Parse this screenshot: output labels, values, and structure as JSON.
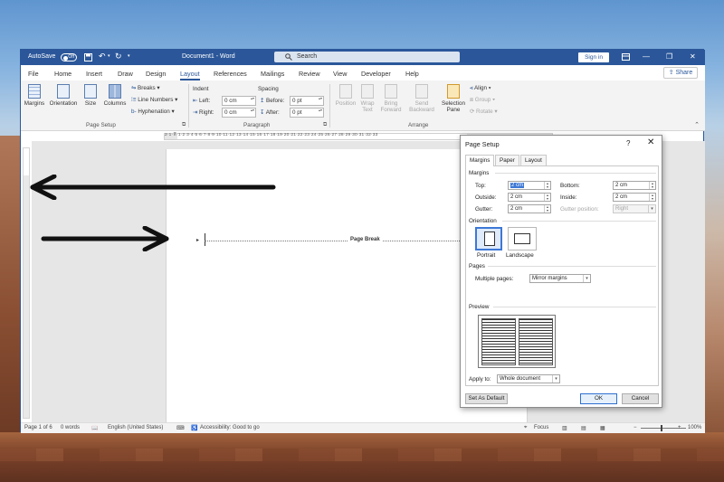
{
  "title_bar": {
    "autosave_label": "AutoSave",
    "autosave_state": "Off",
    "doc_title": "Document1 - Word",
    "search_placeholder": "Search",
    "signin_label": "Sign in",
    "minimize": "—",
    "restore": "❐",
    "close": "✕"
  },
  "tabs": [
    "File",
    "Home",
    "Insert",
    "Draw",
    "Design",
    "Layout",
    "References",
    "Mailings",
    "Review",
    "View",
    "Developer",
    "Help"
  ],
  "active_tab": "Layout",
  "share_label": "Share",
  "ribbon": {
    "page_setup": {
      "margins": "Margins",
      "orientation": "Orientation",
      "size": "Size",
      "columns": "Columns",
      "breaks": "Breaks",
      "line_numbers": "Line Numbers",
      "hyphenation": "Hyphenation",
      "group_label": "Page Setup"
    },
    "paragraph": {
      "indent_header": "Indent",
      "spacing_header": "Spacing",
      "left_label": "Left:",
      "left_value": "0 cm",
      "right_label": "Right:",
      "right_value": "0 cm",
      "before_label": "Before:",
      "before_value": "0 pt",
      "after_label": "After:",
      "after_value": "0 pt",
      "group_label": "Paragraph"
    },
    "arrange": {
      "position": "Position",
      "wrap_text": "Wrap Text",
      "bring_forward": "Bring Forward",
      "send_backward": "Send Backward",
      "selection_pane": "Selection Pane",
      "align": "Align",
      "group": "Group",
      "rotate": "Rotate",
      "group_label": "Arrange"
    }
  },
  "document": {
    "page_break_label": "Page Break"
  },
  "status_bar": {
    "page": "Page 1 of 6",
    "words": "0 words",
    "language": "English (United States)",
    "accessibility": "Accessibility: Good to go",
    "focus": "Focus",
    "zoom_minus": "−",
    "zoom_plus": "+",
    "zoom": "100%"
  },
  "dialog": {
    "title": "Page Setup",
    "help": "?",
    "close": "✕",
    "tabs": [
      "Margins",
      "Paper",
      "Layout"
    ],
    "active_tab": "Margins",
    "margins_header": "Margins",
    "top_label": "Top:",
    "top_value": "2 cm",
    "bottom_label": "Bottom:",
    "bottom_value": "2 cm",
    "outside_label": "Outside:",
    "outside_value": "2 cm",
    "inside_label": "Inside:",
    "inside_value": "2 cm",
    "gutter_label": "Gutter:",
    "gutter_value": "2 cm",
    "gutter_position_label": "Gutter position:",
    "gutter_position_value": "Right",
    "orientation_header": "Orientation",
    "portrait": "Portrait",
    "landscape": "Landscape",
    "pages_header": "Pages",
    "multiple_pages_label": "Multiple pages:",
    "multiple_pages_value": "Mirror margins",
    "preview_header": "Preview",
    "apply_to_label": "Apply to:",
    "apply_to_value": "Whole document",
    "set_default": "Set As Default",
    "ok": "OK",
    "cancel": "Cancel"
  },
  "colors": {
    "word_blue": "#2b579a",
    "dialog_selection": "#3d78d6",
    "annotation_arrow": "#111111"
  },
  "icons": [
    "autosave-toggle",
    "save-icon",
    "undo-icon",
    "redo-icon",
    "search-icon",
    "margins-icon",
    "orientation-icon",
    "size-icon",
    "columns-icon",
    "breaks-icon",
    "line-numbers-icon",
    "hyphenation-icon",
    "position-icon",
    "wrap-text-icon",
    "bring-forward-icon",
    "send-backward-icon",
    "selection-pane-icon",
    "align-icon",
    "group-icon",
    "rotate-icon",
    "annotation-arrow-left",
    "annotation-arrow-right"
  ]
}
